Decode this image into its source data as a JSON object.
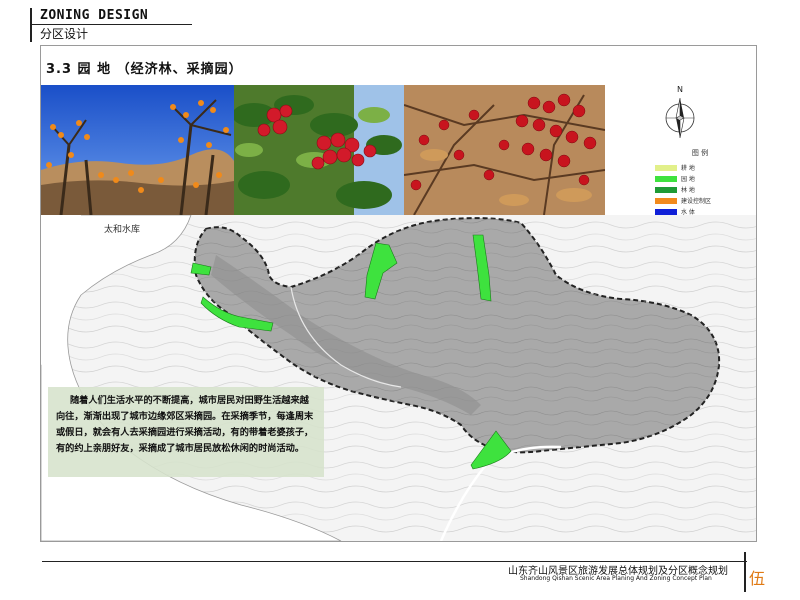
{
  "header": {
    "title": "ZONING DESIGN",
    "subtitle": "分区设计"
  },
  "section": {
    "title": "3.3  园  地 （经济林、采摘园）"
  },
  "photos": [
    {
      "subject": "persimmon-orchard"
    },
    {
      "subject": "red-hawthorn-branch"
    },
    {
      "subject": "hawthorn-fruit-cluster"
    }
  ],
  "map": {
    "lake_label": "太和水库"
  },
  "legend": {
    "title": "图  例",
    "items": [
      {
        "label": "耕  地",
        "color": "#e2f08a"
      },
      {
        "label": "园  地",
        "color": "#3ee23e"
      },
      {
        "label": "林  地",
        "color": "#1f9a35"
      },
      {
        "label": "建设控制区",
        "color": "#f28a1c"
      },
      {
        "label": "水  体",
        "color": "#1020d8"
      }
    ]
  },
  "compass": {
    "label": "N"
  },
  "description": "随着人们生活水平的不断提高，城市居民对田野生活越来越向往，渐渐出现了城市边缘郊区采摘园。在采摘季节，每逢周末或假日，就会有人去采摘园进行采摘活动，有的带着老婆孩子，有的约上亲朋好友，采摘成了城市居民放松休闲的时尚活动。",
  "footer": {
    "title_cn": "山东齐山风景区旅游发展总体规划及分区概念规划",
    "title_en": "Shandong Qishan Scenic Area Planing And Zoning Concept Plan",
    "page": "伍"
  }
}
